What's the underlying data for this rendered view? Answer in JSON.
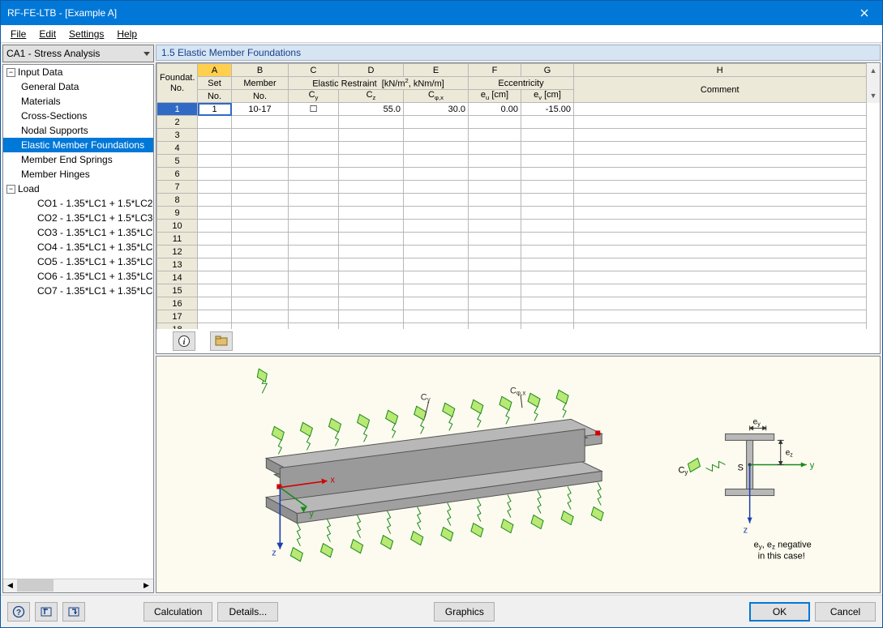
{
  "window": {
    "title": "RF-FE-LTB - [Example A]"
  },
  "menu": {
    "file": "File",
    "edit": "Edit",
    "settings": "Settings",
    "help": "Help"
  },
  "combo": {
    "value": "CA1 - Stress Analysis"
  },
  "tree": {
    "input_data": "Input Data",
    "general_data": "General Data",
    "materials": "Materials",
    "cross_sections": "Cross-Sections",
    "nodal_supports": "Nodal Supports",
    "elastic_member_foundations": "Elastic Member Foundations",
    "member_end_springs": "Member End Springs",
    "member_hinges": "Member Hinges",
    "load": "Load",
    "co1": "CO1 - 1.35*LC1 + 1.5*LC2",
    "co2": "CO2 - 1.35*LC1 + 1.5*LC3",
    "co3": "CO3 - 1.35*LC1 + 1.35*LC",
    "co4": "CO4 - 1.35*LC1 + 1.35*LC",
    "co5": "CO5 - 1.35*LC1 + 1.35*LC",
    "co6": "CO6 - 1.35*LC1 + 1.35*LC",
    "co7": "CO7 - 1.35*LC1 + 1.35*LC"
  },
  "panel": {
    "title": "1.5 Elastic Member Foundations"
  },
  "grid": {
    "cols": {
      "A": "A",
      "B": "B",
      "C": "C",
      "D": "D",
      "E": "E",
      "F": "F",
      "G": "G",
      "H": "H"
    },
    "h1": {
      "foundat_no": "Foundat.\nNo.",
      "set": "Set",
      "member": "Member",
      "elastic_restraint": "Elastic Restraint  [kN/m², kNm/m]",
      "eccentricity": "Eccentricity",
      "comment": "Comment"
    },
    "h2": {
      "set_no": "No.",
      "member_no": "No.",
      "cy": "C y",
      "cz": "C z",
      "cphi": "C φ,x",
      "eu": "e u [cm]",
      "ev": "e v [cm]"
    },
    "row1": {
      "set_no": "1",
      "member_no": "10-17",
      "cy": "☐",
      "cz": "55.0",
      "cphi": "30.0",
      "eu": "0.00",
      "ev": "-15.00",
      "comment": ""
    },
    "rowcount": 18
  },
  "diagram": {
    "cy_label": "Cy",
    "cphi_label": "Cφ,x",
    "s": "S",
    "x": "x",
    "y": "y",
    "z": "z",
    "ey": "ey",
    "ez": "ez",
    "note1": "ey, ez negative",
    "note2": "in this case!"
  },
  "buttons": {
    "calculation": "Calculation",
    "details": "Details...",
    "graphics": "Graphics",
    "ok": "OK",
    "cancel": "Cancel"
  }
}
